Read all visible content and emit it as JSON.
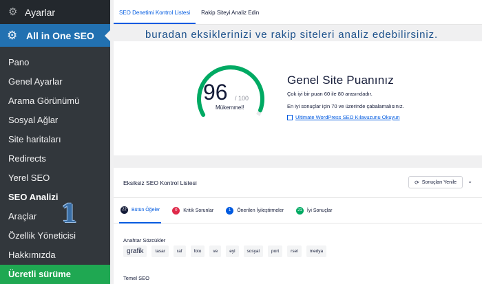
{
  "sidebar": {
    "top_label": "Ayarlar",
    "plugin_label": "All in One SEO",
    "items": [
      {
        "label": "Pano"
      },
      {
        "label": "Genel Ayarlar"
      },
      {
        "label": "Arama Görünümü"
      },
      {
        "label": "Sosyal Ağlar"
      },
      {
        "label": "Site haritaları"
      },
      {
        "label": "Redirects"
      },
      {
        "label": "Yerel SEO"
      },
      {
        "label": "SEO Analizi"
      },
      {
        "label": "Araçlar"
      },
      {
        "label": "Özellik Yöneticisi"
      },
      {
        "label": "Hakkımızda"
      }
    ],
    "annotation_number": "1",
    "upgrade_label": "Ücretli sürüme"
  },
  "tabs": [
    {
      "label": "SEO Denetimi Kontrol Listesi"
    },
    {
      "label": "Rakip Siteyi Analiz Edin"
    }
  ],
  "overlay_text": "buradan eksiklerinizi ve rakip siteleri analiz edebilirsiniz.",
  "score": {
    "value": "96",
    "denominator": "/ 100",
    "fraction": 0.96,
    "label": "Mükemmel!",
    "title": "Genel Site Puanınız",
    "line1": "Çok iyi bir puan 60 ile 80 arasındadır.",
    "line2": "En iyi sonuçlar için 70 ve üzerinde çabalamalısınız.",
    "link": "Ultimate WordPress SEO Kılavuzunu Okuyun",
    "color": "#00aa63"
  },
  "checklist": {
    "title": "Eksiksiz SEO Kontrol Listesi",
    "refresh_label": "Sonuçları Yenile",
    "filters": [
      {
        "count": "22",
        "label": "Bütün Öğeler",
        "color": "#141b38"
      },
      {
        "count": "0",
        "label": "Kritik Sorunlar",
        "color": "#df2a4a"
      },
      {
        "count": "1",
        "label": "Önerilen İyileştirmeler",
        "color": "#005ae0"
      },
      {
        "count": "21",
        "label": "İyi Sonuçlar",
        "color": "#00aa63"
      }
    ],
    "keywords_title": "Anahtar Sözcükler",
    "keywords": [
      "grafik",
      "tasar",
      "raf",
      "foto",
      "ve",
      "eyl",
      "sosyal",
      "port",
      "rsel",
      "medya"
    ],
    "section_title": "Temel SEO"
  }
}
